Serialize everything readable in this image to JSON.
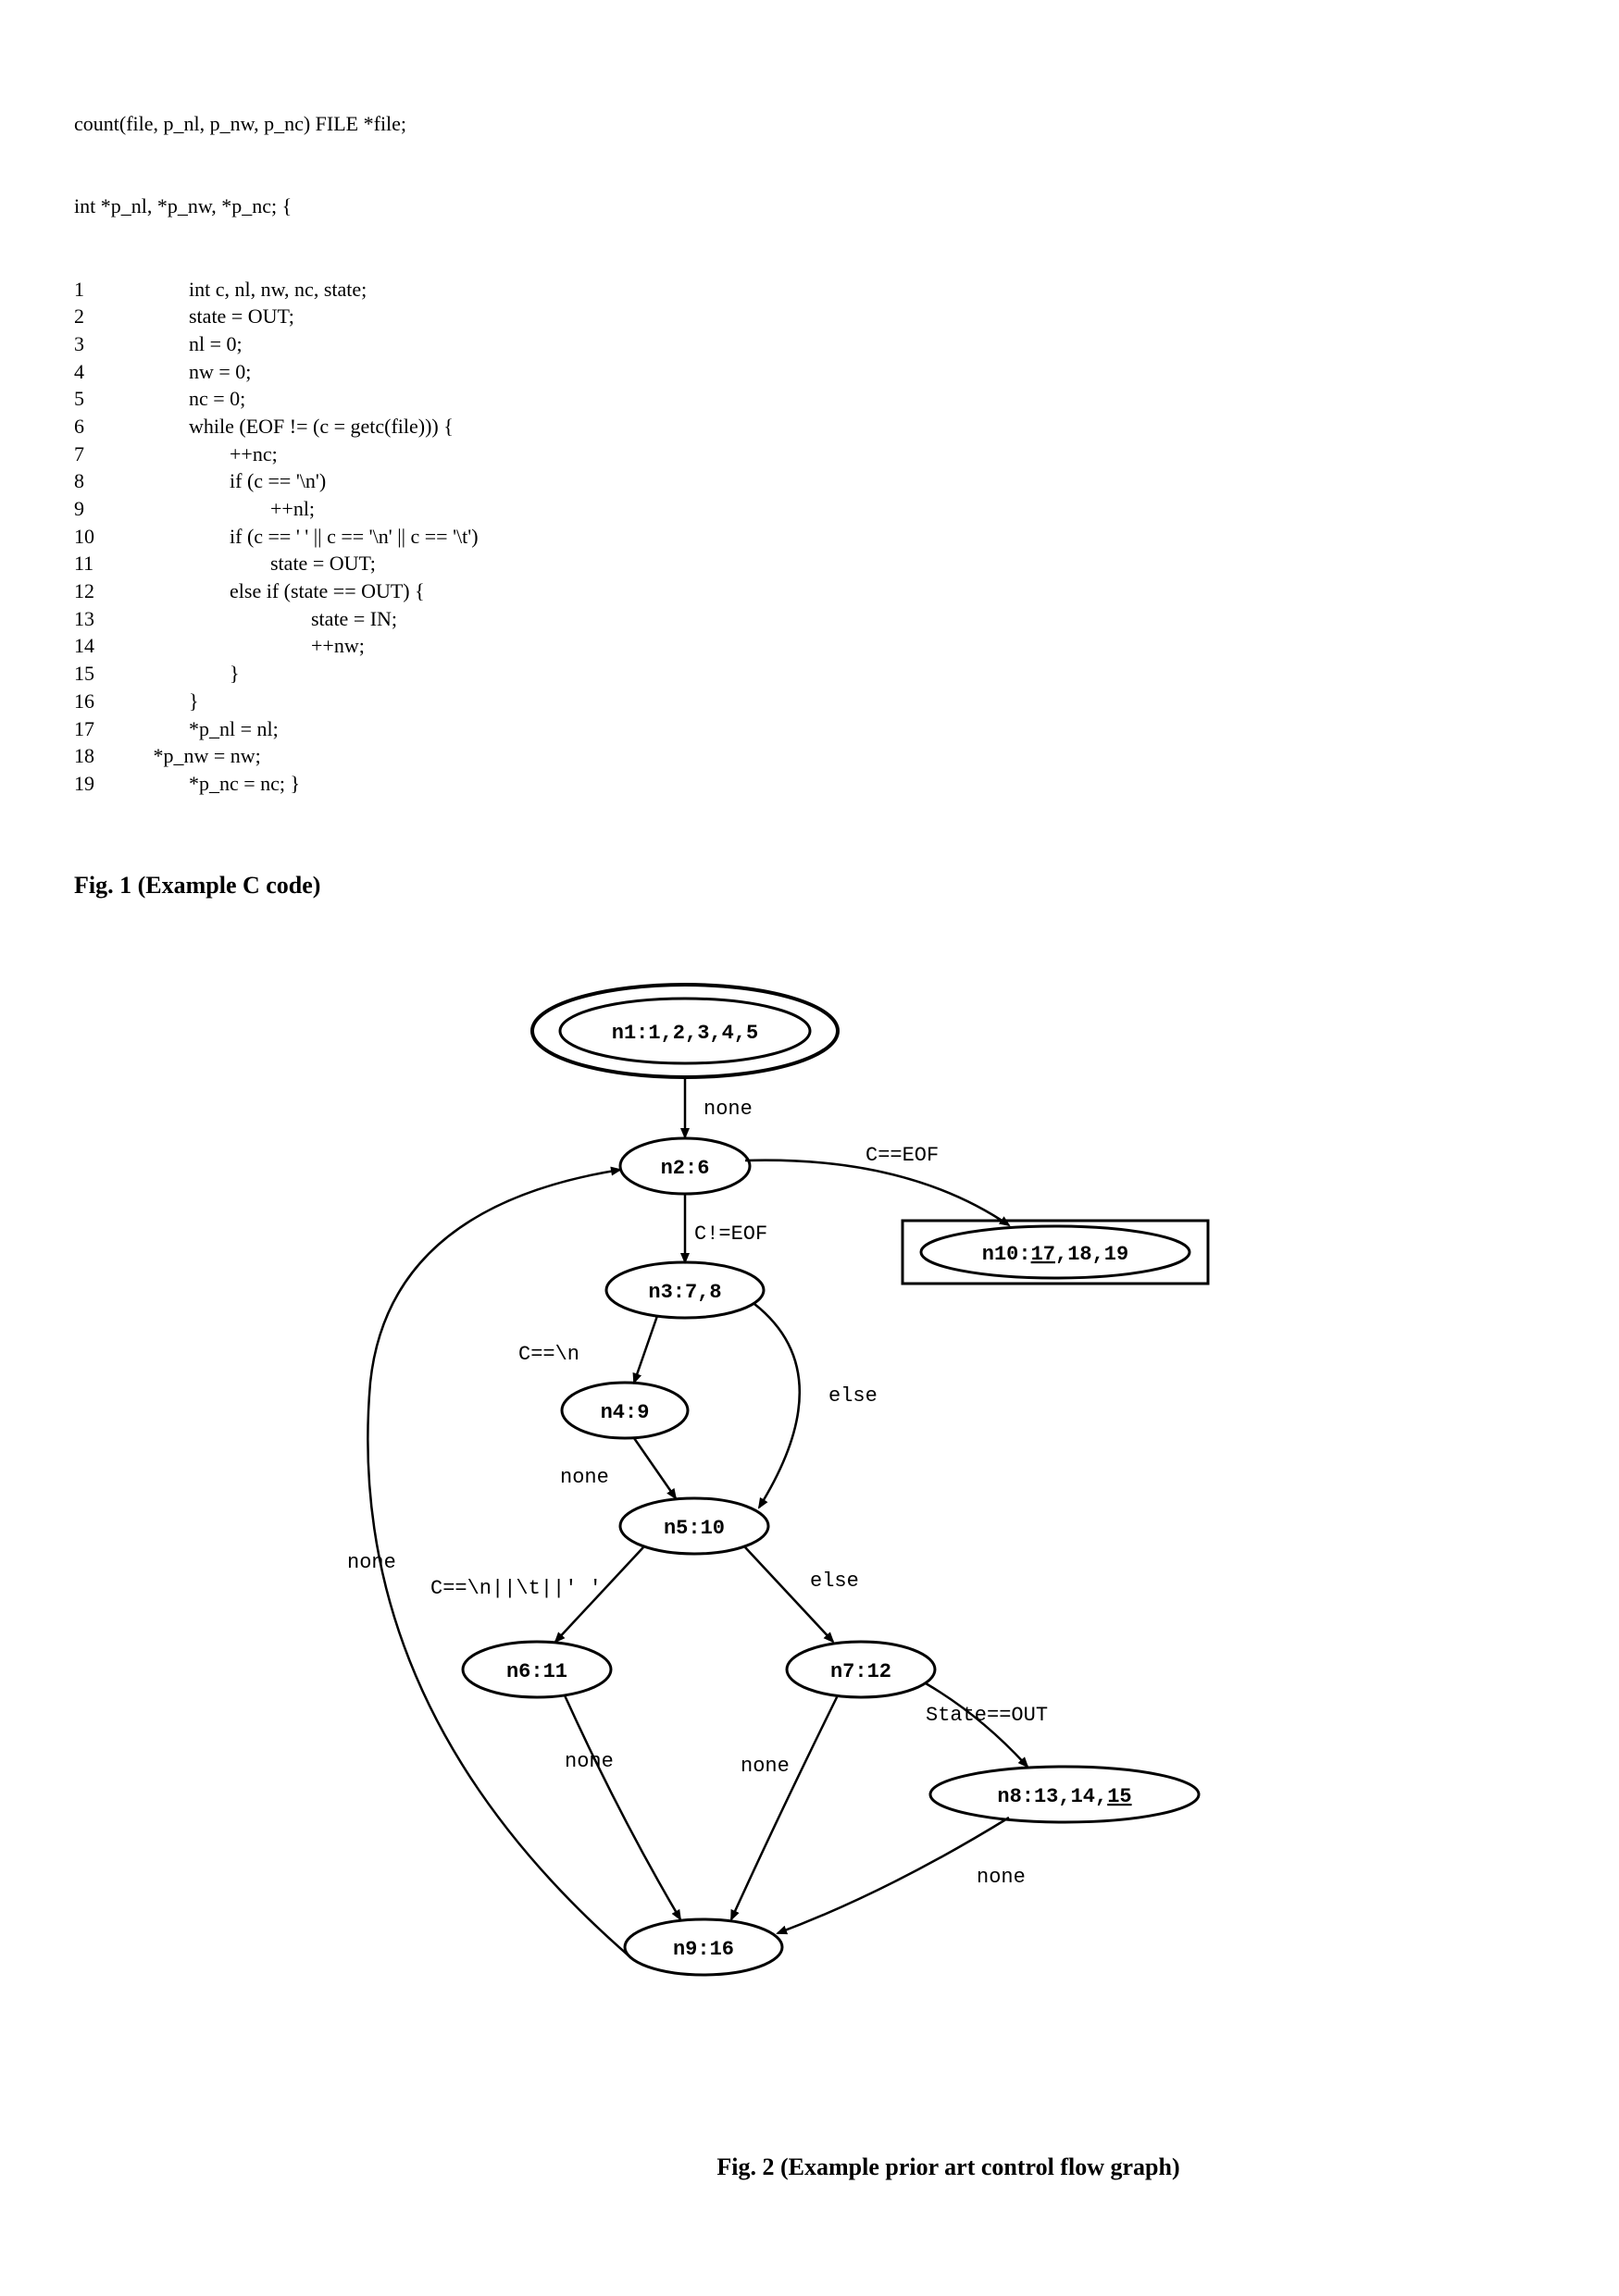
{
  "code": {
    "signature": "count(file, p_nl, p_nw, p_nc) FILE *file;",
    "decl": "int *p_nl, *p_nw, *p_nc; {",
    "lines": [
      {
        "n": "1",
        "text": "        int c, nl, nw, nc, state;"
      },
      {
        "n": "2",
        "text": "        state = OUT;"
      },
      {
        "n": "3",
        "text": "        nl = 0;"
      },
      {
        "n": "4",
        "text": "        nw = 0;"
      },
      {
        "n": "5",
        "text": "        nc = 0;"
      },
      {
        "n": "6",
        "text": "        while (EOF != (c = getc(file))) {"
      },
      {
        "n": "7",
        "text": "                ++nc;"
      },
      {
        "n": "8",
        "text": "                if (c == '\\n')"
      },
      {
        "n": "9",
        "text": "                        ++nl;"
      },
      {
        "n": "10",
        "text": "                if (c == ' ' || c == '\\n' || c == '\\t')"
      },
      {
        "n": "11",
        "text": "                        state = OUT;"
      },
      {
        "n": "12",
        "text": "                else if (state == OUT) {"
      },
      {
        "n": "13",
        "text": "                                state = IN;"
      },
      {
        "n": "14",
        "text": "                                ++nw;"
      },
      {
        "n": "15",
        "text": "                }"
      },
      {
        "n": "16",
        "text": "        }"
      },
      {
        "n": "17",
        "text": "        *p_nl = nl;"
      },
      {
        "n": "18",
        "text": " *p_nw = nw;"
      },
      {
        "n": "19",
        "text": "        *p_nc = nc; }"
      }
    ]
  },
  "fig1_caption": "Fig. 1 (Example C code)",
  "fig2_caption": "Fig. 2 (Example prior art control flow graph)",
  "nodes": {
    "n1": "n1:1,2,3,4,5",
    "n2": "n2:6",
    "n3": "n3:7,8",
    "n4": "n4:9",
    "n5": "n5:10",
    "n6": "n6:11",
    "n7": "n7:12",
    "n8": "n8:13,14,15",
    "n9": "n9:16",
    "n10": "n10:17,18,19"
  },
  "edges": {
    "n1_n2": "none",
    "n2_n10": "C==EOF",
    "n2_n3": "C!=EOF",
    "n3_n4": "C==\\n",
    "n3_n5": "else",
    "n4_n5": "none",
    "n5_n6": "C==\\n||\\t||' '",
    "n5_n7": "else",
    "n6_n9": "none",
    "n7_n9": "none",
    "n7_n8": "State==OUT",
    "n8_n9": "none",
    "n9_n2": "none"
  }
}
